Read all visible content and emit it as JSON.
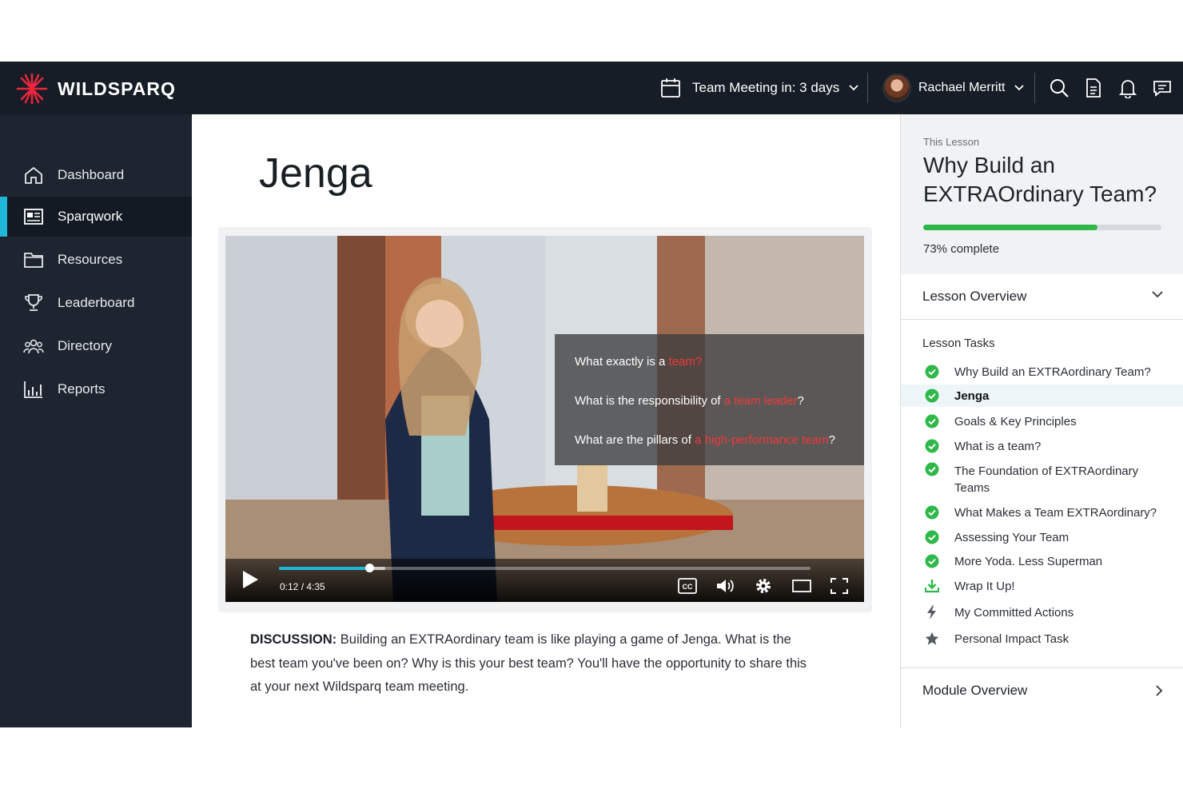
{
  "app": {
    "brand": "WILDSPARQ"
  },
  "header": {
    "meeting_label": "Team Meeting in: 3 days",
    "user_name": "Rachael Merritt",
    "icons": [
      "search-icon",
      "document-icon",
      "bell-icon",
      "chat-icon"
    ]
  },
  "sidebar": {
    "items": [
      {
        "label": "Dashboard",
        "icon": "home-icon"
      },
      {
        "label": "Sparqwork",
        "icon": "newspaper-icon",
        "active": true
      },
      {
        "label": "Resources",
        "icon": "folder-icon"
      },
      {
        "label": "Leaderboard",
        "icon": "trophy-icon"
      },
      {
        "label": "Directory",
        "icon": "people-icon"
      },
      {
        "label": "Reports",
        "icon": "chart-icon"
      }
    ]
  },
  "main": {
    "title": "Jenga",
    "video": {
      "questions": [
        {
          "pre": "What exactly is a ",
          "hl": "team?",
          "post": ""
        },
        {
          "pre": "What is the responsibility of ",
          "hl": "a team leader",
          "post": "?"
        },
        {
          "pre": "What are the pillars of ",
          "hl": "a high-performance team",
          "post": "?"
        }
      ],
      "time": "0:12 / 4:35",
      "progress": 0.17,
      "buffered": 0.2
    },
    "discussion_label": "DISCUSSION:",
    "discussion_text": " Building an EXTRAordinary team is like playing a game of Jenga. What is the best team you've been on? Why is this your best team? You'll have the opportunity to share this at your next Wildsparq team meeting."
  },
  "panel": {
    "this_lesson_label": "This Lesson",
    "lesson_title": "Why Build an EXTRAOrdinary Team?",
    "progress_fraction": 0.73,
    "progress_text": "73% complete",
    "lesson_overview": "Lesson Overview",
    "tasks_label": "Lesson Tasks",
    "tasks": [
      {
        "label": "Why Build an EXTRAordinary Team?",
        "icon": "check-circle-icon"
      },
      {
        "label": "Jenga",
        "icon": "check-circle-icon",
        "active": true
      },
      {
        "label": "Goals & Key Principles",
        "icon": "check-circle-icon"
      },
      {
        "label": "What is a team?",
        "icon": "check-circle-icon"
      },
      {
        "label": "The Foundation of EXTRAordinary Teams",
        "icon": "check-circle-icon"
      },
      {
        "label": "What Makes a Team EXTRAordinary?",
        "icon": "check-circle-icon"
      },
      {
        "label": "Assessing Your Team",
        "icon": "check-circle-icon"
      },
      {
        "label": "More Yoda. Less Superman",
        "icon": "check-circle-icon"
      },
      {
        "label": "Wrap It Up!",
        "icon": "download-icon"
      },
      {
        "label": "My Committed Actions",
        "icon": "lightning-icon"
      },
      {
        "label": "Personal Impact Task",
        "icon": "star-icon"
      }
    ],
    "module_overview": "Module Overview"
  },
  "colors": {
    "accent": "#1fb6d9",
    "success": "#2fb84a",
    "highlight": "#f03a3a",
    "topbar": "#161d26",
    "sidebar": "#1e2530"
  }
}
